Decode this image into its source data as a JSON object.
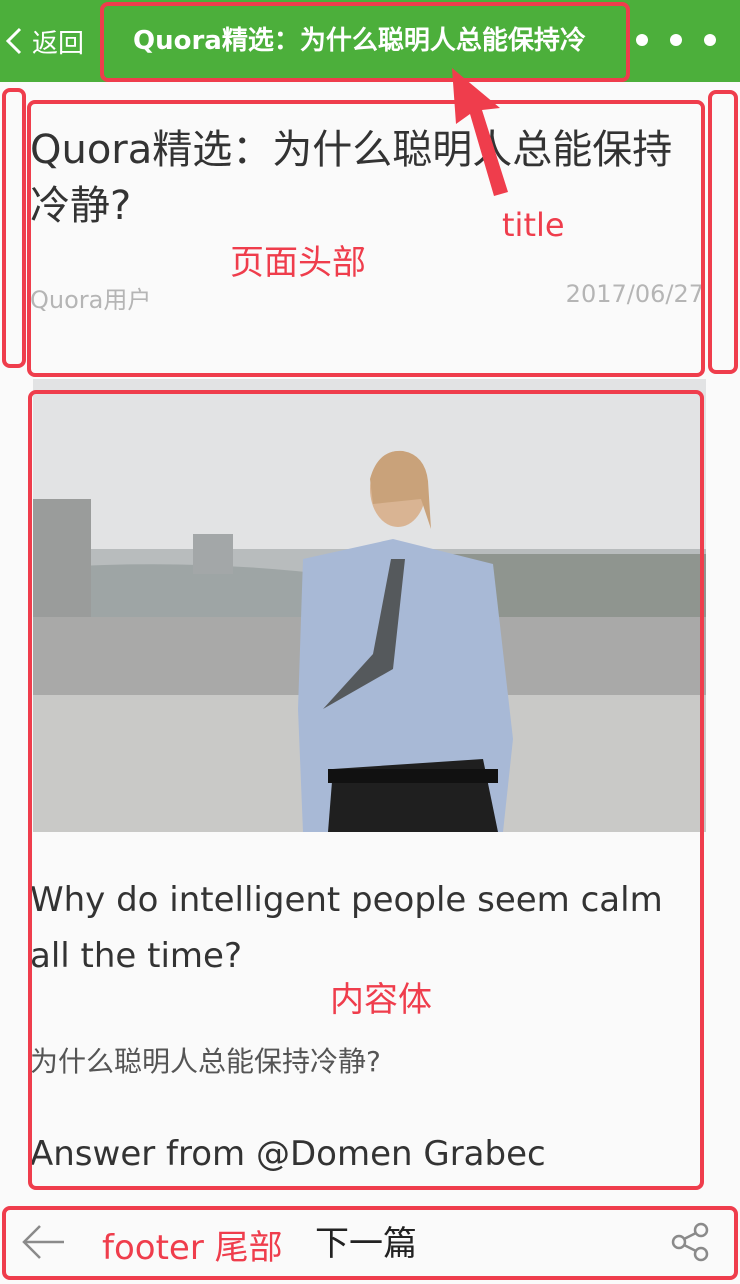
{
  "nav": {
    "back_label": "返回",
    "title": "Quora精选：为什么聪明人总能保持冷"
  },
  "article": {
    "title": "Quora精选：为什么聪明人总能保持冷静?",
    "author": "Quora用户",
    "date": "2017/06/27",
    "question_en": "Why do intelligent people seem calm all the time?",
    "question_zh": "为什么聪明人总能保持冷静?",
    "answer_from": "Answer from @Domen Grabec"
  },
  "footer": {
    "next_label": "下一篇"
  },
  "annotations": {
    "title_note": "title",
    "header_note": "页面头部",
    "content_note": "内容体",
    "footer_note": "footer 尾部"
  },
  "colors": {
    "nav_bg": "#4caf3b",
    "annotation": "#ef3d4c"
  },
  "icons": [
    "chevron-left-icon",
    "more-dots-icon",
    "arrow-left-icon",
    "share-icon"
  ]
}
